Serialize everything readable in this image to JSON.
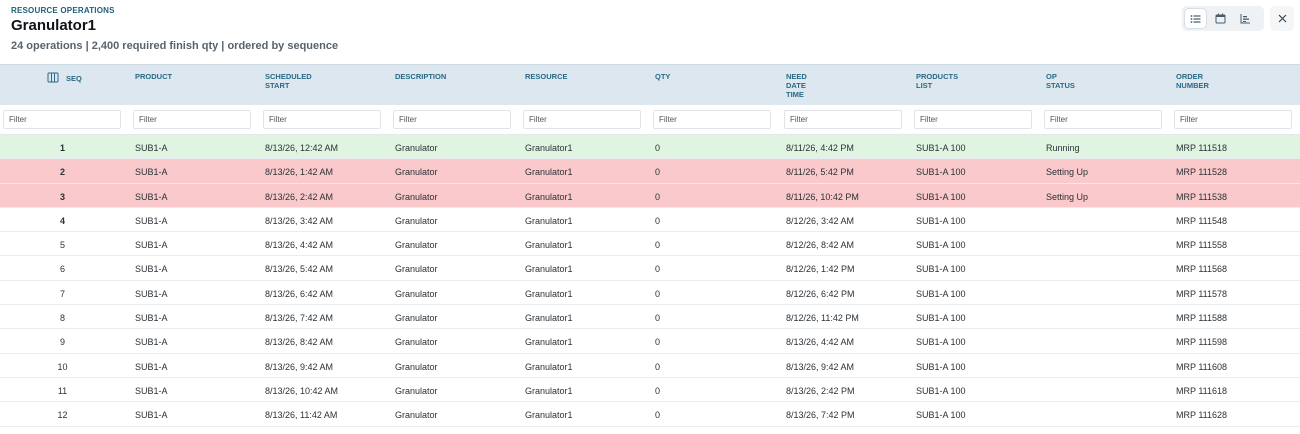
{
  "header": {
    "eyebrow": "RESOURCE OPERATIONS",
    "title": "Granulator1",
    "subtitle": "24 operations | 2,400 required finish qty | ordered by sequence"
  },
  "toolbar": {
    "icons": [
      "list-view-icon",
      "calendar-view-icon",
      "chart-view-icon",
      "close-icon"
    ]
  },
  "columns": {
    "seq": "SEQ",
    "product": "PRODUCT",
    "scheduled_start_1": "SCHEDULED",
    "scheduled_start_2": "START",
    "description": "DESCRIPTION",
    "resource": "RESOURCE",
    "qty": "QTY",
    "need_1": "NEED",
    "need_2": "DATE",
    "need_3": "TIME",
    "products_1": "PRODUCTS",
    "products_2": "LIST",
    "op_1": "OP",
    "op_2": "STATUS",
    "order_1": "ORDER",
    "order_2": "NUMBER"
  },
  "filter_placeholder": "Filter",
  "rows": [
    {
      "seq": "1",
      "product": "SUB1-A",
      "start": "8/13/26, 12:42 AM",
      "description": "Granulator",
      "resource": "Granulator1",
      "qty": "0",
      "need": "8/11/26, 4:42 PM",
      "products": "SUB1-A 100",
      "status": "Running",
      "order": "MRP 111518"
    },
    {
      "seq": "2",
      "product": "SUB1-A",
      "start": "8/13/26, 1:42 AM",
      "description": "Granulator",
      "resource": "Granulator1",
      "qty": "0",
      "need": "8/11/26, 5:42 PM",
      "products": "SUB1-A 100",
      "status": "Setting Up",
      "order": "MRP 111528"
    },
    {
      "seq": "3",
      "product": "SUB1-A",
      "start": "8/13/26, 2:42 AM",
      "description": "Granulator",
      "resource": "Granulator1",
      "qty": "0",
      "need": "8/11/26, 10:42 PM",
      "products": "SUB1-A 100",
      "status": "Setting Up",
      "order": "MRP 111538"
    },
    {
      "seq": "4",
      "product": "SUB1-A",
      "start": "8/13/26, 3:42 AM",
      "description": "Granulator",
      "resource": "Granulator1",
      "qty": "0",
      "need": "8/12/26, 3:42 AM",
      "products": "SUB1-A 100",
      "status": "",
      "order": "MRP 111548"
    },
    {
      "seq": "5",
      "product": "SUB1-A",
      "start": "8/13/26, 4:42 AM",
      "description": "Granulator",
      "resource": "Granulator1",
      "qty": "0",
      "need": "8/12/26, 8:42 AM",
      "products": "SUB1-A 100",
      "status": "",
      "order": "MRP 111558"
    },
    {
      "seq": "6",
      "product": "SUB1-A",
      "start": "8/13/26, 5:42 AM",
      "description": "Granulator",
      "resource": "Granulator1",
      "qty": "0",
      "need": "8/12/26, 1:42 PM",
      "products": "SUB1-A 100",
      "status": "",
      "order": "MRP 111568"
    },
    {
      "seq": "7",
      "product": "SUB1-A",
      "start": "8/13/26, 6:42 AM",
      "description": "Granulator",
      "resource": "Granulator1",
      "qty": "0",
      "need": "8/12/26, 6:42 PM",
      "products": "SUB1-A 100",
      "status": "",
      "order": "MRP 111578"
    },
    {
      "seq": "8",
      "product": "SUB1-A",
      "start": "8/13/26, 7:42 AM",
      "description": "Granulator",
      "resource": "Granulator1",
      "qty": "0",
      "need": "8/12/26, 11:42 PM",
      "products": "SUB1-A 100",
      "status": "",
      "order": "MRP 111588"
    },
    {
      "seq": "9",
      "product": "SUB1-A",
      "start": "8/13/26, 8:42 AM",
      "description": "Granulator",
      "resource": "Granulator1",
      "qty": "0",
      "need": "8/13/26, 4:42 AM",
      "products": "SUB1-A 100",
      "status": "",
      "order": "MRP 111598"
    },
    {
      "seq": "10",
      "product": "SUB1-A",
      "start": "8/13/26, 9:42 AM",
      "description": "Granulator",
      "resource": "Granulator1",
      "qty": "0",
      "need": "8/13/26, 9:42 AM",
      "products": "SUB1-A 100",
      "status": "",
      "order": "MRP 111608"
    },
    {
      "seq": "11",
      "product": "SUB1-A",
      "start": "8/13/26, 10:42 AM",
      "description": "Granulator",
      "resource": "Granulator1",
      "qty": "0",
      "need": "8/13/26, 2:42 PM",
      "products": "SUB1-A 100",
      "status": "",
      "order": "MRP 111618"
    },
    {
      "seq": "12",
      "product": "SUB1-A",
      "start": "8/13/26, 11:42 AM",
      "description": "Granulator",
      "resource": "Granulator1",
      "qty": "0",
      "need": "8/13/26, 7:42 PM",
      "products": "SUB1-A 100",
      "status": "",
      "order": "MRP 111628"
    }
  ],
  "colors": {
    "running_row": "#dff5e1",
    "setup_row": "#f9c9cb",
    "header_bg": "#dce7ef",
    "header_text": "#2a6a85"
  }
}
